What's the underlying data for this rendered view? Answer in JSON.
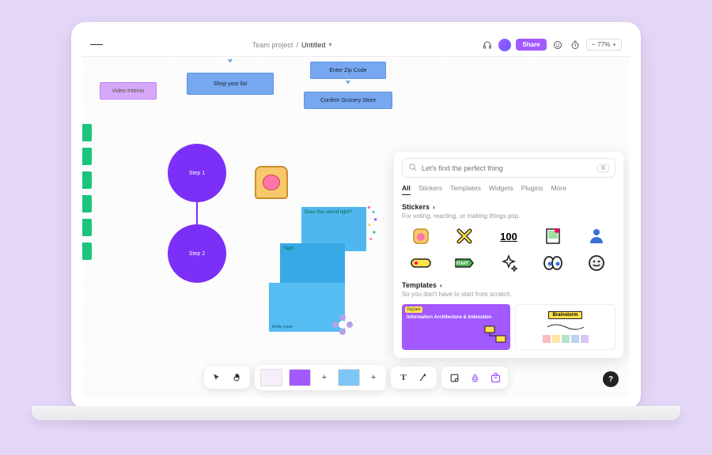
{
  "breadcrumb": {
    "project": "Team project",
    "sep": "/",
    "title": "Untitled",
    "chev": "▾"
  },
  "topbar": {
    "share": "Share",
    "zoom": "77%"
  },
  "canvas": {
    "video_interior": "Video Interior",
    "shop_list": "Shop your list",
    "enter_zip": "Enter Zip Code",
    "confirm_store": "Confirm Grocery Store",
    "step1": "Step 1",
    "step2": "Step 2",
    "sticky_q": "Does this sound right?",
    "sticky_yay": "Yay!!",
    "signature": "Emily Louie"
  },
  "panel": {
    "placeholder": "Let's find the perfect thing",
    "tabs": [
      "All",
      "Stickers",
      "Templates",
      "Widgets",
      "Plugins",
      "More"
    ],
    "stickers_title": "Stickers",
    "stickers_sub": "For voting, reacting, or making things pop.",
    "templates_title": "Templates",
    "templates_sub": "So you don't have to start from scratch.",
    "tmpl_a_badge": "FigJam",
    "tmpl_a_text": "Information Architecture & Indexation",
    "tmpl_b_label": "Brainstorm",
    "hundred": "100"
  },
  "help": "?"
}
